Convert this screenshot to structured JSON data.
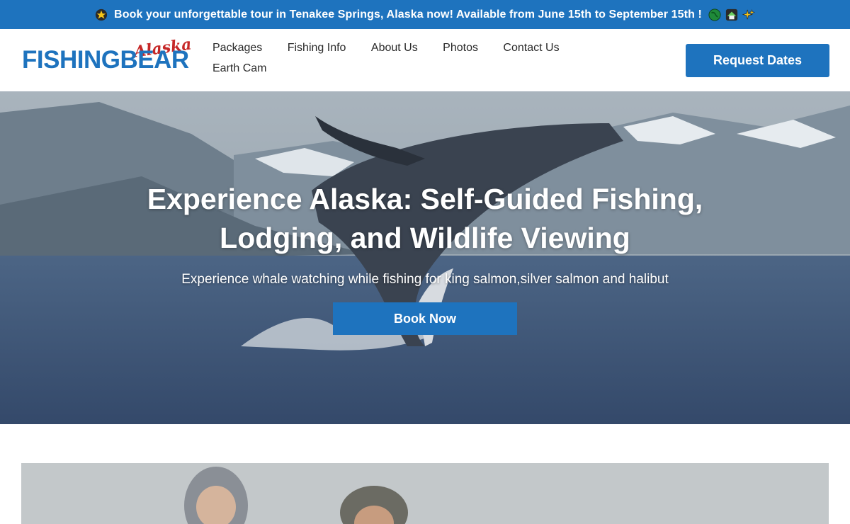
{
  "announcement": {
    "text": "Book your unforgettable tour in Tenakee Springs, Alaska now! Available from June 15th to September 15th !",
    "lead_icon": "star-icon",
    "trail_icons": [
      "globe-icon",
      "house-icon",
      "sparkles-icon"
    ]
  },
  "brand": {
    "logo_word": "FISHINGBEAR",
    "logo_script": "Alaska"
  },
  "nav": {
    "items": [
      "Packages",
      "Fishing Info",
      "About Us",
      "Photos",
      "Contact Us",
      "Earth Cam"
    ]
  },
  "header": {
    "request_label": "Request Dates"
  },
  "hero": {
    "title": "Experience Alaska: Self-Guided Fishing, Lodging, and Wildlife Viewing",
    "subtitle": "Experience whale watching while fishing for king salmon,silver salmon and halibut",
    "cta_label": "Book Now"
  },
  "colors": {
    "brand_blue": "#1e73be",
    "logo_red": "#c62828",
    "sea": "#3d5675"
  }
}
